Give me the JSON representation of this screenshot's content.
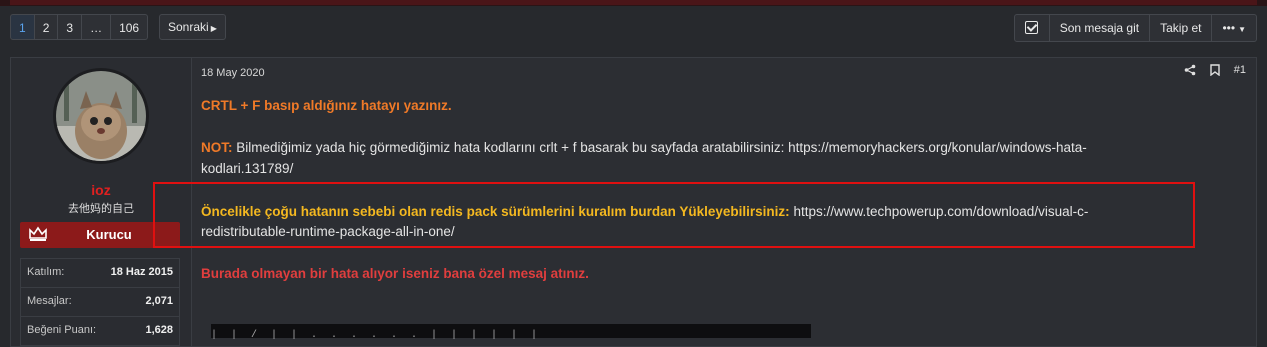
{
  "pagination": {
    "pages": [
      "1",
      "2",
      "3",
      "…",
      "106"
    ],
    "current": "1",
    "next_label": "Sonraki"
  },
  "toolbar": {
    "last_post_label": "Son mesaja git",
    "watch_label": "Takip et",
    "more_label": "•••"
  },
  "user": {
    "name": "ioz",
    "title": "去他妈的自己",
    "rank": "Kurucu",
    "stats": [
      {
        "key": "Katılım:",
        "value": "18 Haz 2015"
      },
      {
        "key": "Mesajlar:",
        "value": "2,071"
      },
      {
        "key": "Beğeni Puanı:",
        "value": "1,628"
      }
    ]
  },
  "post": {
    "date": "18 May 2020",
    "number": "#1",
    "line1": "CRTL + F basıp aldığınız hatayı yazınız.",
    "note_label": "NOT:",
    "note_text": " Bilmediğimiz yada hiç görmediğimiz hata kodlarını crlt + f basarak bu sayfada aratabilirsiniz: https://memoryhackers.org/konular/windows-hata-",
    "note_text2": "kodlari.131789/",
    "redis_label": "Öncelikle çoğu hatanın sebebi olan redis pack sürümlerini kuralım burdan Yükleyebilirsiniz:",
    "redis_url1": " https://www.techpowerup.com/download/visual-c-",
    "redis_url2": "redistributable-runtime-package-all-in-one/",
    "line_last": "Burada olmayan bir hata alıyor iseniz bana özel mesaj atınız."
  },
  "colors": {
    "orange": "#f07a28",
    "yellow": "#f4b820",
    "red": "#e03e3e",
    "highlight_box": "#e01010",
    "link_blue": "#5aa3ee"
  }
}
